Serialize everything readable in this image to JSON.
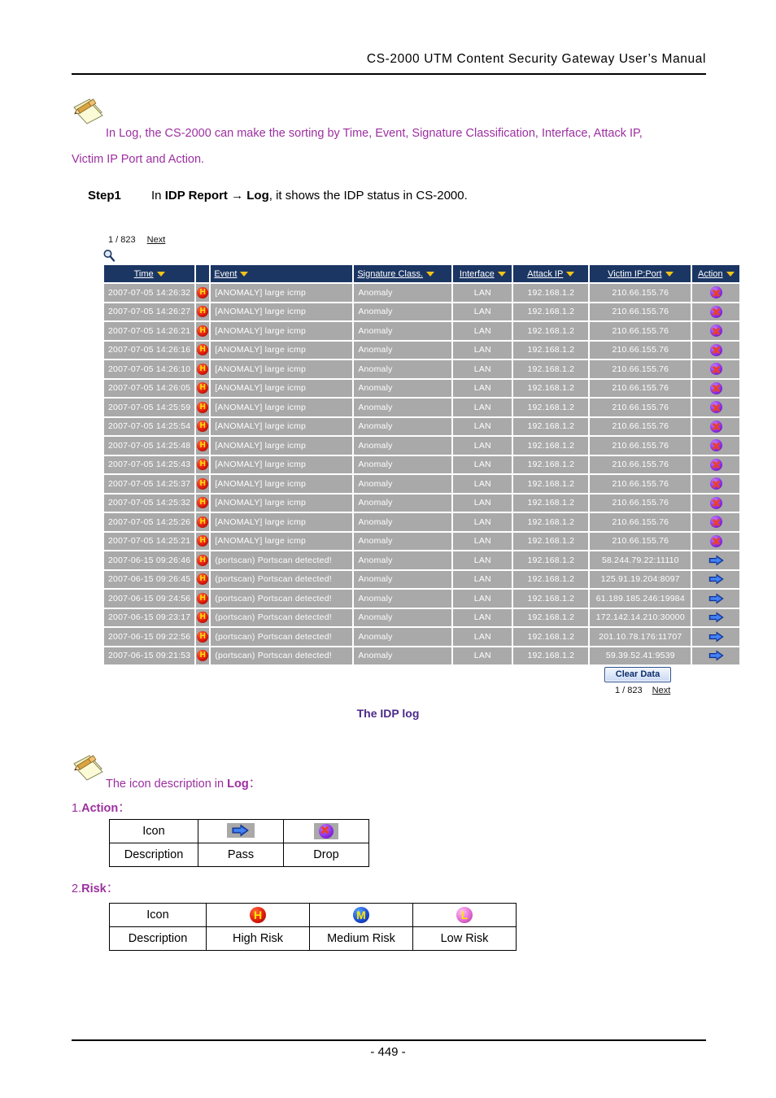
{
  "document": {
    "header_title": "CS-2000  UTM  Content  Security  Gateway  User’s  Manual",
    "page_number": "- 449 -"
  },
  "note_top": {
    "icon": "pencil-note-icon",
    "line1": "In Log, the CS-2000 can make the sorting by Time, Event, Signature Classification, Interface, Attack IP,",
    "line2": "Victim IP Port and Action."
  },
  "step": {
    "label": "Step1",
    "text_before": "In ",
    "bold1": "IDP Report",
    "arrow": " → ",
    "bold2": "Log",
    "text_after": ", it shows the IDP status in CS-2000."
  },
  "log_panel": {
    "pager_top": {
      "count": "1 / 823",
      "next": "Next"
    },
    "search_icon": "magnifier-icon",
    "columns": [
      {
        "key": "time",
        "label": "Time",
        "sort": "down"
      },
      {
        "key": "risk",
        "label": "",
        "sort": "none"
      },
      {
        "key": "event",
        "label": "Event",
        "sort": "down"
      },
      {
        "key": "signature",
        "label": "Signature Class.",
        "sort": "down"
      },
      {
        "key": "interface",
        "label": "Interface",
        "sort": "down"
      },
      {
        "key": "attack_ip",
        "label": "Attack IP",
        "sort": "down"
      },
      {
        "key": "victim",
        "label": "Victim IP:Port",
        "sort": "down"
      },
      {
        "key": "action",
        "label": "Action",
        "sort": "down"
      }
    ],
    "rows": [
      {
        "time": "2007-07-05 14:26:32",
        "risk": "H",
        "event": "[ANOMALY] large icmp",
        "signature": "Anomaly",
        "interface": "LAN",
        "attack_ip": "192.168.1.2",
        "victim": "210.66.155.76",
        "action": "drop"
      },
      {
        "time": "2007-07-05 14:26:27",
        "risk": "H",
        "event": "[ANOMALY] large icmp",
        "signature": "Anomaly",
        "interface": "LAN",
        "attack_ip": "192.168.1.2",
        "victim": "210.66.155.76",
        "action": "drop"
      },
      {
        "time": "2007-07-05 14:26:21",
        "risk": "H",
        "event": "[ANOMALY] large icmp",
        "signature": "Anomaly",
        "interface": "LAN",
        "attack_ip": "192.168.1.2",
        "victim": "210.66.155.76",
        "action": "drop"
      },
      {
        "time": "2007-07-05 14:26:16",
        "risk": "H",
        "event": "[ANOMALY] large icmp",
        "signature": "Anomaly",
        "interface": "LAN",
        "attack_ip": "192.168.1.2",
        "victim": "210.66.155.76",
        "action": "drop"
      },
      {
        "time": "2007-07-05 14:26:10",
        "risk": "H",
        "event": "[ANOMALY] large icmp",
        "signature": "Anomaly",
        "interface": "LAN",
        "attack_ip": "192.168.1.2",
        "victim": "210.66.155.76",
        "action": "drop"
      },
      {
        "time": "2007-07-05 14:26:05",
        "risk": "H",
        "event": "[ANOMALY] large icmp",
        "signature": "Anomaly",
        "interface": "LAN",
        "attack_ip": "192.168.1.2",
        "victim": "210.66.155.76",
        "action": "drop"
      },
      {
        "time": "2007-07-05 14:25:59",
        "risk": "H",
        "event": "[ANOMALY] large icmp",
        "signature": "Anomaly",
        "interface": "LAN",
        "attack_ip": "192.168.1.2",
        "victim": "210.66.155.76",
        "action": "drop"
      },
      {
        "time": "2007-07-05 14:25:54",
        "risk": "H",
        "event": "[ANOMALY] large icmp",
        "signature": "Anomaly",
        "interface": "LAN",
        "attack_ip": "192.168.1.2",
        "victim": "210.66.155.76",
        "action": "drop"
      },
      {
        "time": "2007-07-05 14:25:48",
        "risk": "H",
        "event": "[ANOMALY] large icmp",
        "signature": "Anomaly",
        "interface": "LAN",
        "attack_ip": "192.168.1.2",
        "victim": "210.66.155.76",
        "action": "drop"
      },
      {
        "time": "2007-07-05 14:25:43",
        "risk": "H",
        "event": "[ANOMALY] large icmp",
        "signature": "Anomaly",
        "interface": "LAN",
        "attack_ip": "192.168.1.2",
        "victim": "210.66.155.76",
        "action": "drop"
      },
      {
        "time": "2007-07-05 14:25:37",
        "risk": "H",
        "event": "[ANOMALY] large icmp",
        "signature": "Anomaly",
        "interface": "LAN",
        "attack_ip": "192.168.1.2",
        "victim": "210.66.155.76",
        "action": "drop"
      },
      {
        "time": "2007-07-05 14:25:32",
        "risk": "H",
        "event": "[ANOMALY] large icmp",
        "signature": "Anomaly",
        "interface": "LAN",
        "attack_ip": "192.168.1.2",
        "victim": "210.66.155.76",
        "action": "drop"
      },
      {
        "time": "2007-07-05 14:25:26",
        "risk": "H",
        "event": "[ANOMALY] large icmp",
        "signature": "Anomaly",
        "interface": "LAN",
        "attack_ip": "192.168.1.2",
        "victim": "210.66.155.76",
        "action": "drop"
      },
      {
        "time": "2007-07-05 14:25:21",
        "risk": "H",
        "event": "[ANOMALY] large icmp",
        "signature": "Anomaly",
        "interface": "LAN",
        "attack_ip": "192.168.1.2",
        "victim": "210.66.155.76",
        "action": "drop"
      },
      {
        "time": "2007-06-15 09:26:46",
        "risk": "H",
        "event": "(portscan) Portscan detected!",
        "signature": "Anomaly",
        "interface": "LAN",
        "attack_ip": "192.168.1.2",
        "victim": "58.244.79.22:11110",
        "action": "pass"
      },
      {
        "time": "2007-06-15 09:26:45",
        "risk": "H",
        "event": "(portscan) Portscan detected!",
        "signature": "Anomaly",
        "interface": "LAN",
        "attack_ip": "192.168.1.2",
        "victim": "125.91.19.204:8097",
        "action": "pass"
      },
      {
        "time": "2007-06-15 09:24:56",
        "risk": "H",
        "event": "(portscan) Portscan detected!",
        "signature": "Anomaly",
        "interface": "LAN",
        "attack_ip": "192.168.1.2",
        "victim": "61.189.185.246:19984",
        "action": "pass"
      },
      {
        "time": "2007-06-15 09:23:17",
        "risk": "H",
        "event": "(portscan) Portscan detected!",
        "signature": "Anomaly",
        "interface": "LAN",
        "attack_ip": "192.168.1.2",
        "victim": "172.142.14.210:30000",
        "action": "pass"
      },
      {
        "time": "2007-06-15 09:22:56",
        "risk": "H",
        "event": "(portscan) Portscan detected!",
        "signature": "Anomaly",
        "interface": "LAN",
        "attack_ip": "192.168.1.2",
        "victim": "201.10.78.176:11707",
        "action": "pass"
      },
      {
        "time": "2007-06-15 09:21:53",
        "risk": "H",
        "event": "(portscan) Portscan detected!",
        "signature": "Anomaly",
        "interface": "LAN",
        "attack_ip": "192.168.1.2",
        "victim": "59.39.52.41:9539",
        "action": "pass"
      }
    ],
    "clear_button": "Clear Data",
    "pager_bottom": {
      "count": "1 / 823",
      "next": "Next"
    }
  },
  "caption": "The IDP log",
  "note_bottom": {
    "icon": "pencil-note-icon",
    "text_before": "The icon description in ",
    "bold": "Log",
    "text_after": "："
  },
  "section_action": {
    "number": "1.",
    "title": "Action",
    "colon": "："
  },
  "section_risk": {
    "number": "2.",
    "title": "Risk",
    "colon": "："
  },
  "legend_action": {
    "row_labels": [
      "Icon",
      "Description"
    ],
    "items": [
      {
        "icon": "pass-arrow-icon",
        "description": "Pass"
      },
      {
        "icon": "drop-x-icon",
        "description": "Drop"
      }
    ]
  },
  "legend_risk": {
    "row_labels": [
      "Icon",
      "Description"
    ],
    "items": [
      {
        "icon": "high-risk-icon",
        "glyph": "H",
        "description": "High Risk"
      },
      {
        "icon": "medium-risk-icon",
        "glyph": "M",
        "description": "Medium Risk"
      },
      {
        "icon": "low-risk-icon",
        "glyph": "L",
        "description": "Low Risk"
      }
    ]
  },
  "colors": {
    "header_bar": "#1b3663",
    "row_bg": "#a9a9a9",
    "note_text": "#9c2fa0",
    "caption": "#4b2a8a",
    "sort_arrow": "#f3c31a"
  }
}
